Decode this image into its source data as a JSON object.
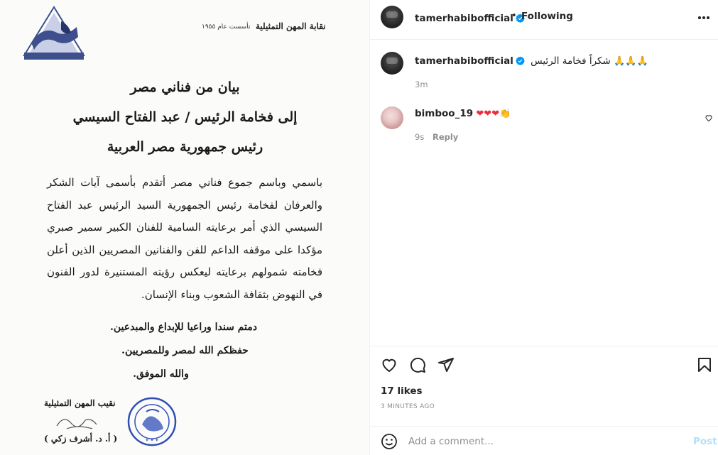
{
  "document": {
    "header_name": "نقابة المهن التمثيلية",
    "header_established": "تأسست عام ١٩٥٥",
    "logo_caption": "نقابة المهن التمثيلية",
    "title_line1": "بيان من فناني مصر",
    "title_line2": "إلى فخامة الرئيس / عبد الفتاح السيسي",
    "title_line3": "رئيس جمهورية مصر العربية",
    "body": "باسمي وباسم جموع فناني مصر أتقدم بأسمى آيات الشكر والعرفان لفخامة رئيس الجمهورية السيد الرئيس عبد الفتاح السيسي الذي أمر برعايته السامية للفنان الكبير سمير صبري مؤكدا على موقفه الداعم للفن والفنانين المصريين الذين أعلن فخامته شمولهم برعايته ليعكس رؤيته المستنيرة لدور الفنون في النهوض بثقافة الشعوب وبناء الإنسان.",
    "closing1": "دمتم سندا وراعيا للإبداع والمبدعين.",
    "closing2": "حفظكم الله لمصر وللمصريين.",
    "closing3": "والله الموفق.",
    "signature_title": "نقيب المهن التمثيلية",
    "signature_name": "( أ. د. أشرف زكي )"
  },
  "post": {
    "author": "tamerhabibofficial",
    "separator": "•",
    "follow_status": "Following",
    "caption_text": "شكراً فخامة الرئيس",
    "caption_emojis": "🙏🙏🙏",
    "caption_time": "3m",
    "comments": [
      {
        "user": "bimboo_19",
        "emojis": "❤❤❤",
        "clap": "👏",
        "time": "9s",
        "reply_label": "Reply"
      }
    ],
    "likes": "17 likes",
    "posted_time": "3 MINUTES AGO",
    "comment_placeholder": "Add a comment...",
    "post_button": "Post"
  },
  "icons": {
    "verified": "verified-badge-icon",
    "more": "more-options-icon",
    "like": "heart-icon",
    "comment": "comment-bubble-icon",
    "share": "paper-plane-icon",
    "save": "bookmark-icon",
    "emoji": "emoji-smile-icon"
  },
  "colors": {
    "verified_blue": "#0095f6",
    "post_disabled": "#b2dffc",
    "hearts_red": "#ed2f3d",
    "stamp_blue": "#2f4fb6",
    "logo_blue": "#3d4f8c"
  }
}
